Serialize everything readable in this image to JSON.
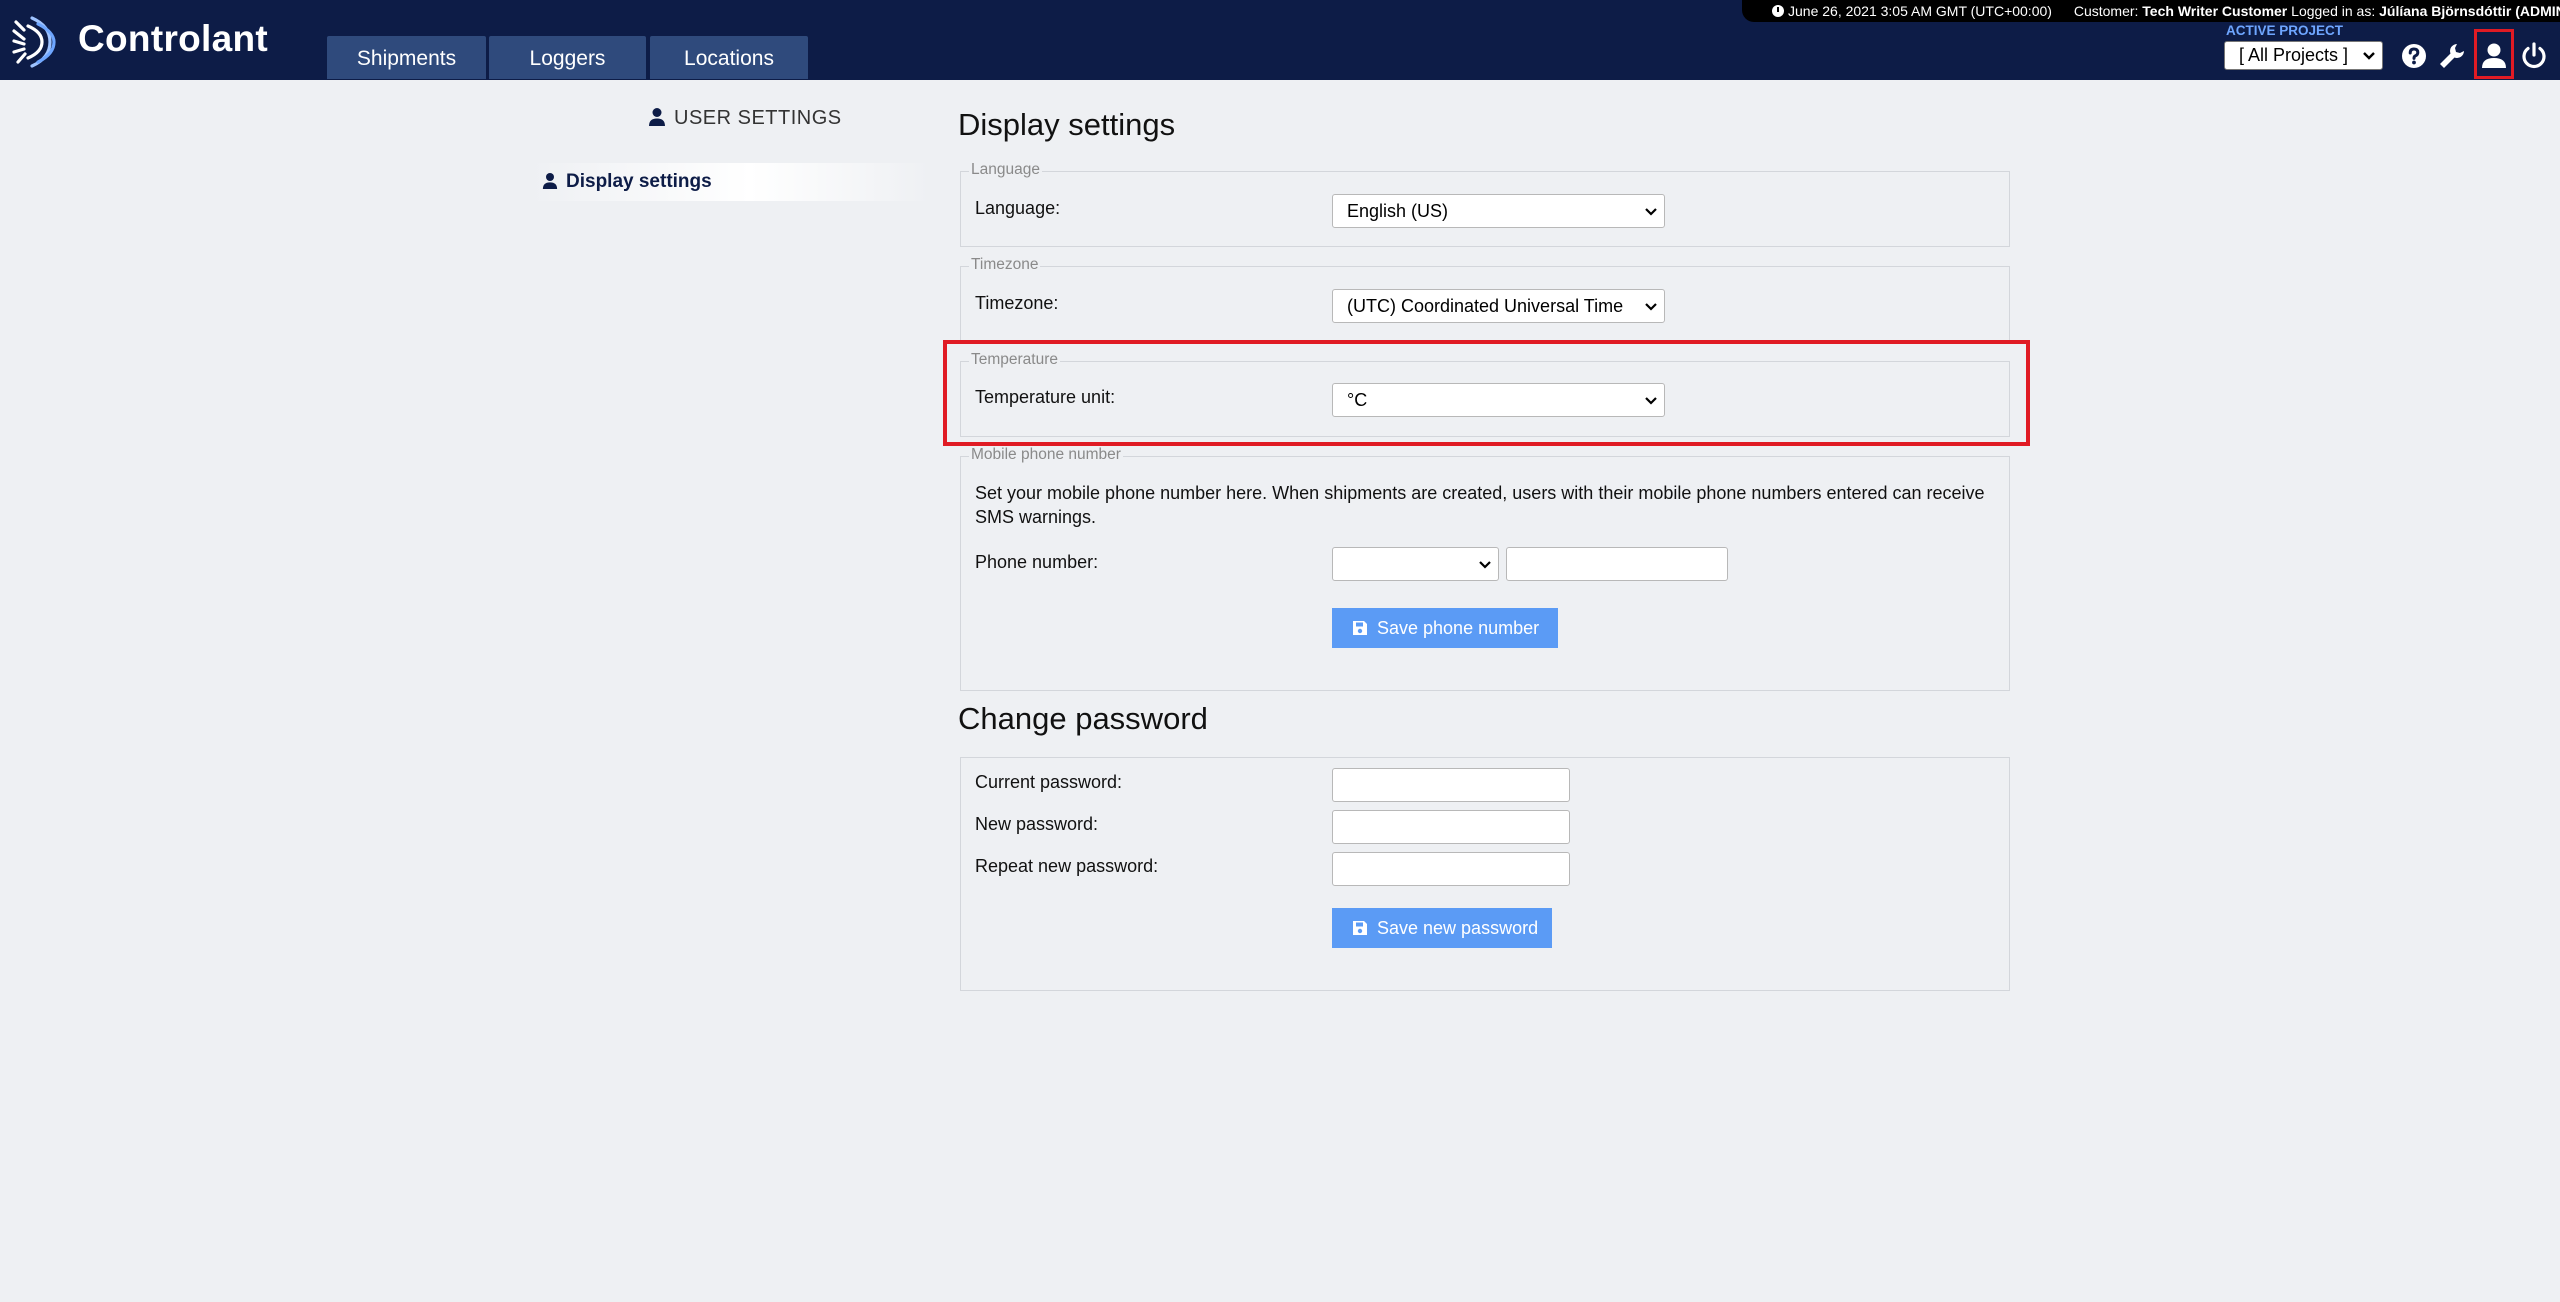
{
  "header": {
    "brand": "Controlant",
    "nav_tabs": [
      {
        "label": "Shipments"
      },
      {
        "label": "Loggers"
      },
      {
        "label": "Locations"
      }
    ],
    "status": {
      "datetime": "June 26, 2021 3:05 AM GMT (UTC+00:00)",
      "customer_label": "Customer:",
      "customer_name": "Tech Writer Customer",
      "logged_in_label": "Logged in as:",
      "user_name": "Júlíana Björnsdóttir (ADMIN)"
    },
    "active_project_label": "ACTIVE PROJECT",
    "project_select_value": "[ All Projects ]",
    "icons": [
      "help-icon",
      "wrench-icon",
      "user-icon",
      "power-icon"
    ]
  },
  "sidebar": {
    "heading": "USER SETTINGS",
    "items": [
      {
        "label": "Display settings"
      }
    ]
  },
  "display_settings": {
    "title": "Display settings",
    "language": {
      "legend": "Language",
      "label": "Language:",
      "value": "English (US)"
    },
    "timezone": {
      "legend": "Timezone",
      "label": "Timezone:",
      "value": "(UTC) Coordinated Universal Time"
    },
    "temperature": {
      "legend": "Temperature",
      "label": "Temperature unit:",
      "value": "°C"
    },
    "mobile": {
      "legend": "Mobile phone number",
      "help": "Set your mobile phone number here. When shipments are created, users with their mobile phone numbers entered can receive SMS warnings.",
      "label": "Phone number:",
      "country_code_value": "",
      "number_value": "",
      "save_label": "Save phone number"
    }
  },
  "change_password": {
    "title": "Change password",
    "current_label": "Current password:",
    "new_label": "New password:",
    "repeat_label": "Repeat new password:",
    "save_label": "Save new password"
  },
  "colors": {
    "header_bg": "#0d1c47",
    "tab_bg": "#2f4a7c",
    "button_bg": "#5b9bf5",
    "highlight": "#e01b24",
    "active_project": "#6ea6ff"
  }
}
